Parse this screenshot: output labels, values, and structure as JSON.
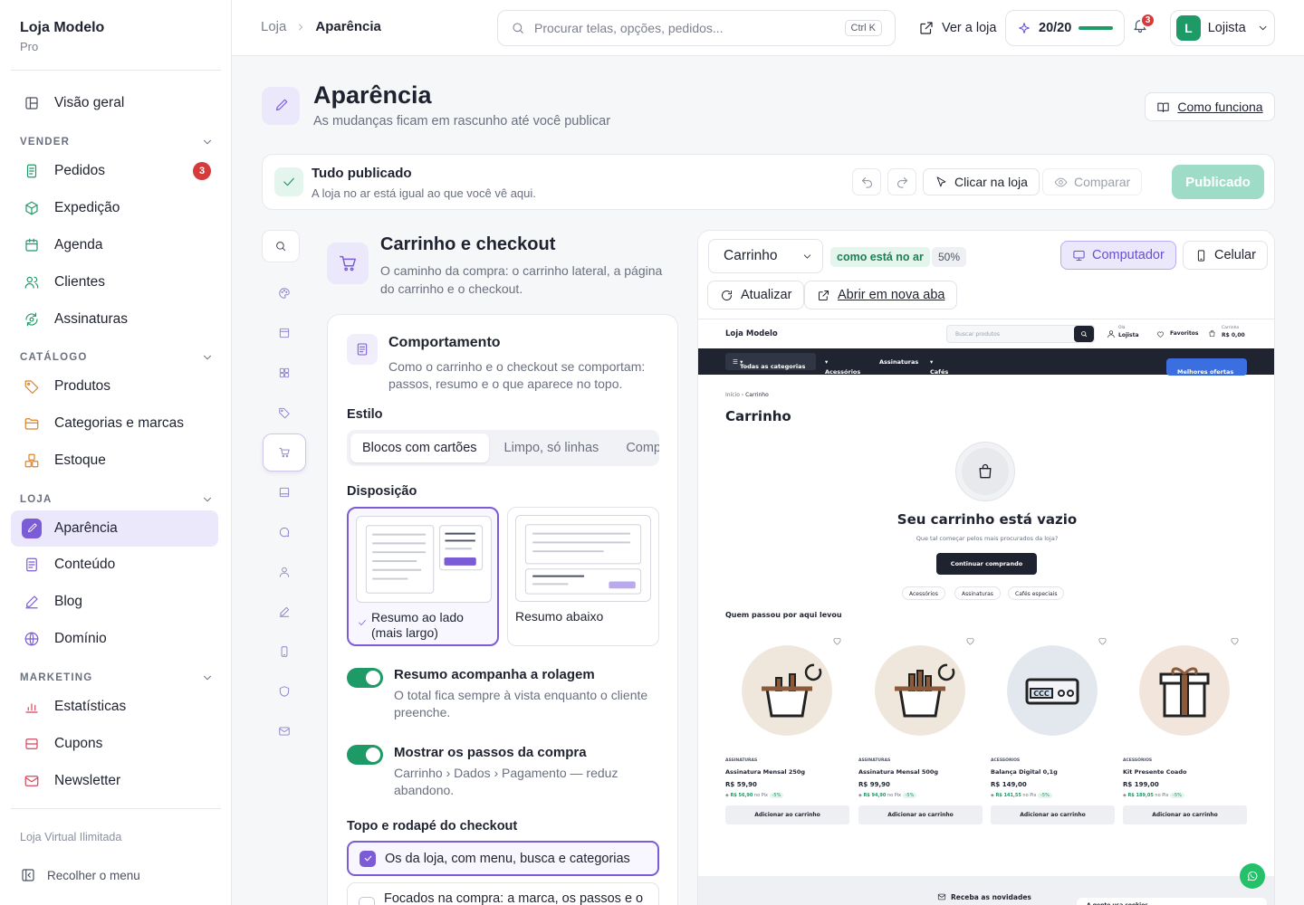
{
  "brand": {
    "name": "Loja Modelo",
    "plan": "Pro"
  },
  "sidebar": {
    "overview": "Visão geral",
    "sections": {
      "vender": "VENDER",
      "catalogo": "CATÁLOGO",
      "loja": "LOJA",
      "marketing": "MARKETING"
    },
    "vender": [
      {
        "label": "Pedidos",
        "icon": "receipt-icon",
        "badge": "3"
      },
      {
        "label": "Expedição",
        "icon": "box-icon"
      },
      {
        "label": "Agenda",
        "icon": "calendar-icon"
      },
      {
        "label": "Clientes",
        "icon": "users-icon"
      },
      {
        "label": "Assinaturas",
        "icon": "refresh-icon"
      }
    ],
    "catalogo": [
      {
        "label": "Produtos",
        "icon": "tag-icon"
      },
      {
        "label": "Categorias e marcas",
        "icon": "folder-icon"
      },
      {
        "label": "Estoque",
        "icon": "stack-icon"
      }
    ],
    "loja": [
      {
        "label": "Aparência",
        "icon": "brush-icon",
        "active": true
      },
      {
        "label": "Conteúdo",
        "icon": "document-icon"
      },
      {
        "label": "Blog",
        "icon": "pen-icon"
      },
      {
        "label": "Domínio",
        "icon": "globe-icon"
      }
    ],
    "marketing": [
      {
        "label": "Estatísticas",
        "icon": "bar-chart-icon"
      },
      {
        "label": "Cupons",
        "icon": "ticket-icon"
      },
      {
        "label": "Newsletter",
        "icon": "mail-icon"
      }
    ],
    "footer_note": "Loja Virtual Ilimitada",
    "collapse_label": "Recolher o menu"
  },
  "topbar": {
    "breadcrumb": [
      "Loja",
      "Aparência"
    ],
    "search_placeholder": "Procurar telas, opções, pedidos...",
    "search_shortcut": "Ctrl K",
    "view_store": "Ver a loja",
    "quota": "20/20",
    "notifications": "3",
    "user": {
      "initial": "L",
      "name": "Lojista"
    }
  },
  "page": {
    "title": "Aparência",
    "subtitle": "As mudanças ficam em rascunho até você publicar",
    "help_link": "Como funciona"
  },
  "publish_bar": {
    "status_title": "Tudo publicado",
    "status_text": "A loja no ar está igual ao que você vê aqui.",
    "click_store": "Clicar na loja",
    "compare": "Comparar",
    "publish": "Publicado"
  },
  "section": {
    "title": "Carrinho e checkout",
    "description": "O caminho da compra: o carrinho lateral, a página do carrinho e o checkout."
  },
  "behavior": {
    "title": "Comportamento",
    "description": "Como o carrinho e o checkout se comportam: passos, resumo e o que aparece no topo.",
    "style_label": "Estilo",
    "style_options": [
      "Blocos com cartões",
      "Limpo, só linhas",
      "Compacto"
    ],
    "layout_label": "Disposição",
    "layout_options": [
      "Resumo ao lado (mais largo)",
      "Resumo abaixo"
    ],
    "toggle1": {
      "title": "Resumo acompanha a rolagem",
      "text": "O total fica sempre à vista enquanto o cliente preenche.",
      "on": true
    },
    "toggle2": {
      "title": "Mostrar os passos da compra",
      "text": "Carrinho › Dados › Pagamento — reduz abandono.",
      "on": true
    },
    "header_label": "Topo e rodapé do checkout",
    "header_options": [
      "Os da loja, com menu, busca e categorias",
      "Focados na compra: a marca, os passos e o"
    ]
  },
  "preview": {
    "page_select": "Carrinho",
    "live_badge": "como está no ar",
    "zoom": "50%",
    "device_desktop": "Computador",
    "device_mobile": "Celular",
    "refresh": "Atualizar",
    "open_tab": "Abrir em nova aba",
    "site": {
      "logo": "Loja Modelo",
      "search_placeholder": "Buscar produtos",
      "greeting": "Olá",
      "account": "Lojista",
      "favorites": "Favoritos",
      "cart_label": "Carrinho",
      "cart_total": "R$ 0,00",
      "nav": [
        "Todas as categorias",
        "Acessórios",
        "Assinaturas",
        "Cafés especiais"
      ],
      "offers": "Melhores ofertas",
      "breadcrumb": [
        "Início",
        "Carrinho"
      ],
      "heading": "Carrinho",
      "empty_title": "Seu carrinho está vazio",
      "empty_text": "Que tal começar pelos mais procurados da loja?",
      "continue": "Continuar comprando",
      "chips": [
        "Acessórios",
        "Assinaturas",
        "Cafés especiais"
      ],
      "recommend_title": "Quem passou por aqui levou",
      "products": [
        {
          "category": "ASSINATURAS",
          "name": "Assinatura Mensal 250g",
          "price": "R$ 59,90",
          "pix": "R$ 56,90",
          "pix_label": "no Pix",
          "discount": "-5%",
          "add": "Adicionar ao carrinho",
          "color": "#efe7dc"
        },
        {
          "category": "ASSINATURAS",
          "name": "Assinatura Mensal 500g",
          "price": "R$ 99,90",
          "pix": "R$ 94,90",
          "pix_label": "no Pix",
          "discount": "-5%",
          "add": "Adicionar ao carrinho",
          "color": "#efe7dc"
        },
        {
          "category": "ACESSÓRIOS",
          "name": "Balança Digital 0,1g",
          "price": "R$ 149,00",
          "pix": "R$ 141,55",
          "pix_label": "no Pix",
          "discount": "-5%",
          "add": "Adicionar ao carrinho",
          "color": "#e3e8ef"
        },
        {
          "category": "ACESSÓRIOS",
          "name": "Kit Presente Coado",
          "price": "R$ 199,00",
          "pix": "R$ 189,05",
          "pix_label": "no Pix",
          "discount": "-5%",
          "add": "Adicionar ao carrinho",
          "color": "#f2e5dc"
        }
      ],
      "newsletter": "Receba as novidades",
      "cookies": "A gente usa cookies"
    }
  },
  "colors": {
    "accent": "#7b5cd6",
    "success": "#1e9a67",
    "danger": "#d63b3b"
  }
}
